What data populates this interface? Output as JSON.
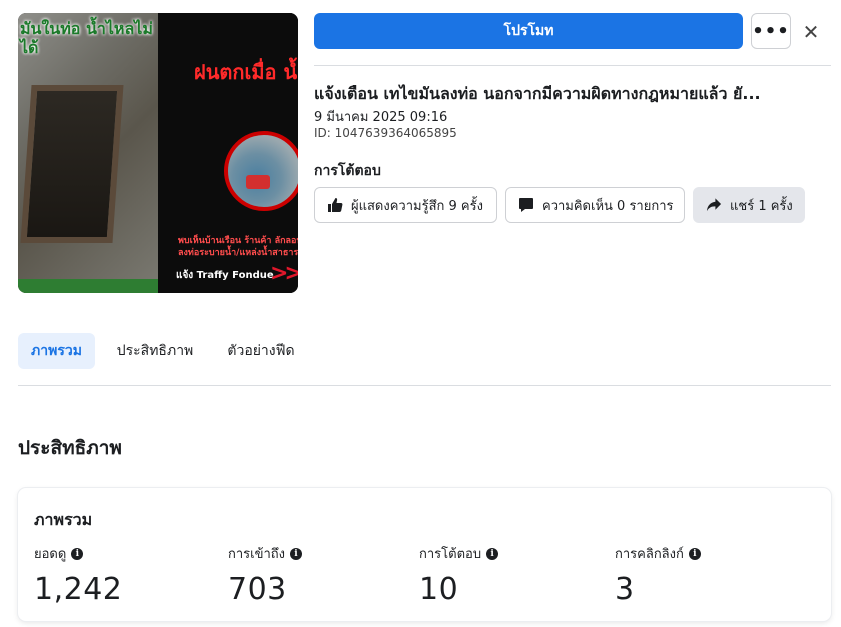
{
  "thumbnail": {
    "top_text": "มันในท่อ น้ำไหลไม่ได้",
    "headline": "ฝนตกเมื่อ น้ำท่วม",
    "caption_line1": "พบเห็นบ้านเรือน ร้านค้า ลักลอบทิ้งน้ำ",
    "caption_line2": "ลงท่อระบายน้ำ/แหล่งน้ำสาธารณะ",
    "brand": "แจ้ง Traffy Fondue",
    "arrows": ">>>"
  },
  "header": {
    "promote_label": "โปรโมท",
    "more_label": "•••",
    "close_label": "✕"
  },
  "post": {
    "title": "แจ้งเตือน เทไขมันลงท่อ นอกจากมีความผิดทางกฎหมายแล้ว ยั...",
    "date": "9 มีนาคม 2025 09:16",
    "id": "ID: 1047639364065895"
  },
  "engagement": {
    "heading": "การโต้ตอบ",
    "likes_label": "ผู้แสดงความรู้สึก 9 ครั้ง",
    "comments_label": "ความคิดเห็น 0 รายการ",
    "shares_label": "แชร์ 1 ครั้ง"
  },
  "tabs": {
    "overview": "ภาพรวม",
    "performance": "ประสิทธิภาพ",
    "samples": "ตัวอย่างฟีด"
  },
  "performance": {
    "heading": "ประสิทธิภาพ",
    "card_title": "ภาพรวม",
    "metrics": [
      {
        "label": "ยอดดู",
        "value": "1,242"
      },
      {
        "label": "การเข้าถึง",
        "value": "703"
      },
      {
        "label": "การโต้ตอบ",
        "value": "10"
      },
      {
        "label": "การคลิกลิงก์",
        "value": "3"
      }
    ]
  },
  "colors": {
    "primary": "#1b74e4",
    "tab_active_bg": "#e7f0fd"
  }
}
